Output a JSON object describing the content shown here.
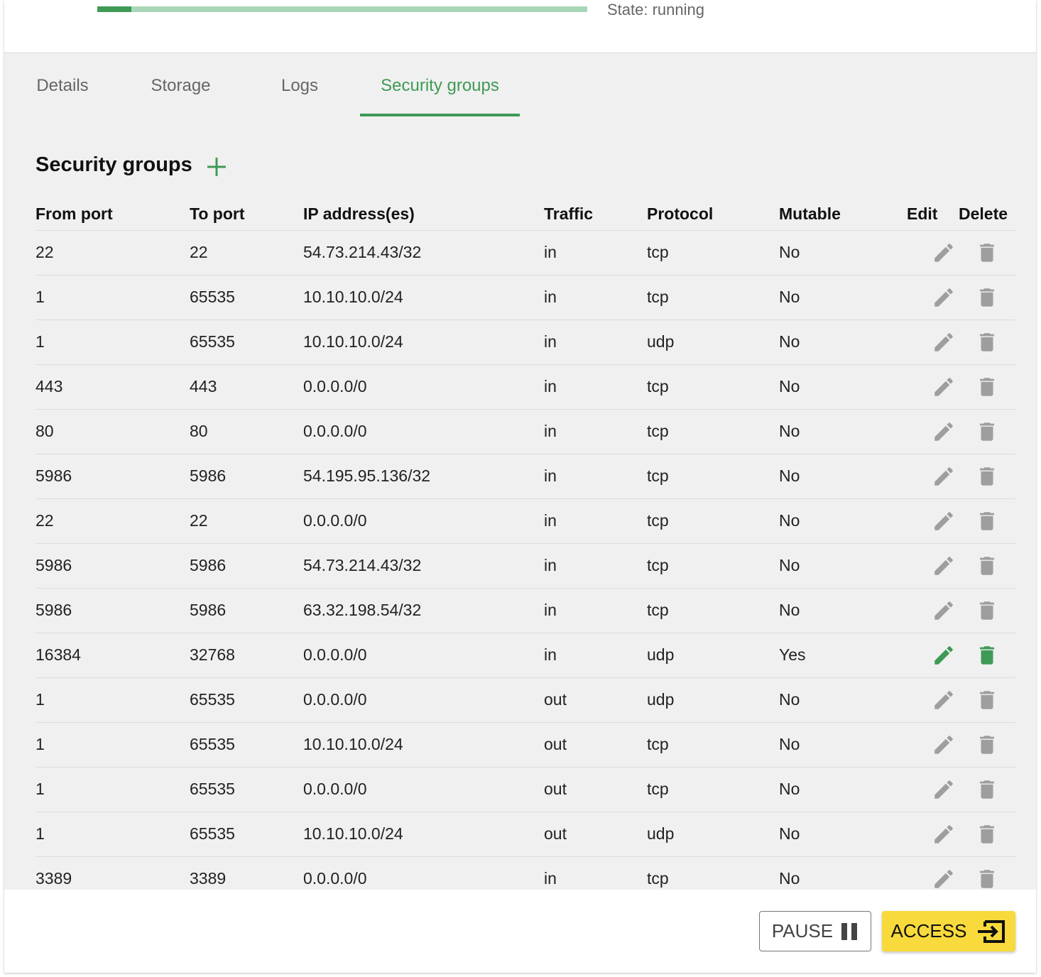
{
  "status": {
    "state_text": "State: running",
    "progress_fraction": 0.07
  },
  "tabs": [
    {
      "label": "Details",
      "active": false
    },
    {
      "label": "Storage",
      "active": false
    },
    {
      "label": "Logs",
      "active": false
    },
    {
      "label": "Security groups",
      "active": true
    }
  ],
  "section": {
    "title": "Security groups",
    "add_icon": "plus-icon"
  },
  "table": {
    "headers": [
      "From port",
      "To port",
      "IP address(es)",
      "Traffic",
      "Protocol",
      "Mutable",
      "Edit",
      "Delete"
    ],
    "rows": [
      {
        "from": "22",
        "to": "22",
        "ip": "54.73.214.43/32",
        "traffic": "in",
        "protocol": "tcp",
        "mutable": "No"
      },
      {
        "from": "1",
        "to": "65535",
        "ip": "10.10.10.0/24",
        "traffic": "in",
        "protocol": "tcp",
        "mutable": "No"
      },
      {
        "from": "1",
        "to": "65535",
        "ip": "10.10.10.0/24",
        "traffic": "in",
        "protocol": "udp",
        "mutable": "No"
      },
      {
        "from": "443",
        "to": "443",
        "ip": "0.0.0.0/0",
        "traffic": "in",
        "protocol": "tcp",
        "mutable": "No"
      },
      {
        "from": "80",
        "to": "80",
        "ip": "0.0.0.0/0",
        "traffic": "in",
        "protocol": "tcp",
        "mutable": "No"
      },
      {
        "from": "5986",
        "to": "5986",
        "ip": "54.195.95.136/32",
        "traffic": "in",
        "protocol": "tcp",
        "mutable": "No"
      },
      {
        "from": "22",
        "to": "22",
        "ip": "0.0.0.0/0",
        "traffic": "in",
        "protocol": "tcp",
        "mutable": "No"
      },
      {
        "from": "5986",
        "to": "5986",
        "ip": "54.73.214.43/32",
        "traffic": "in",
        "protocol": "tcp",
        "mutable": "No"
      },
      {
        "from": "5986",
        "to": "5986",
        "ip": "63.32.198.54/32",
        "traffic": "in",
        "protocol": "tcp",
        "mutable": "No"
      },
      {
        "from": "16384",
        "to": "32768",
        "ip": "0.0.0.0/0",
        "traffic": "in",
        "protocol": "udp",
        "mutable": "Yes"
      },
      {
        "from": "1",
        "to": "65535",
        "ip": "0.0.0.0/0",
        "traffic": "out",
        "protocol": "udp",
        "mutable": "No"
      },
      {
        "from": "1",
        "to": "65535",
        "ip": "10.10.10.0/24",
        "traffic": "out",
        "protocol": "tcp",
        "mutable": "No"
      },
      {
        "from": "1",
        "to": "65535",
        "ip": "0.0.0.0/0",
        "traffic": "out",
        "protocol": "tcp",
        "mutable": "No"
      },
      {
        "from": "1",
        "to": "65535",
        "ip": "10.10.10.0/24",
        "traffic": "out",
        "protocol": "udp",
        "mutable": "No"
      },
      {
        "from": "3389",
        "to": "3389",
        "ip": "0.0.0.0/0",
        "traffic": "in",
        "protocol": "tcp",
        "mutable": "No"
      }
    ],
    "edit_icon": "pencil-icon",
    "delete_icon": "trash-icon"
  },
  "actions": {
    "pause_label": "PAUSE",
    "pause_icon": "pause-icon",
    "access_label": "ACCESS",
    "access_icon": "enter-icon"
  },
  "colors": {
    "accent_green": "#3f9a55",
    "progress_track": "#a9d6b6",
    "icon_disabled": "#9e9e9e",
    "access_yellow": "#f8da3c"
  }
}
